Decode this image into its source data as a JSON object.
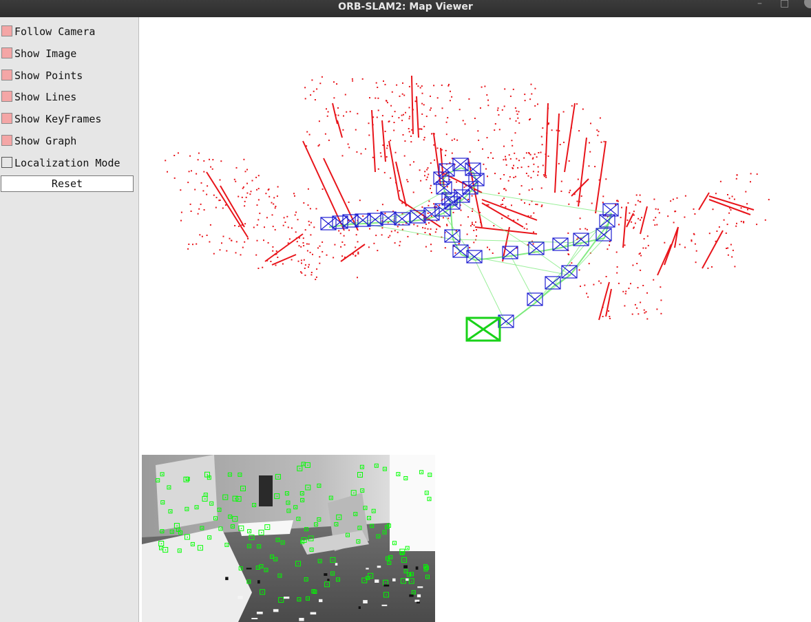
{
  "window": {
    "title": "ORB-SLAM2: Map Viewer"
  },
  "controls": [
    {
      "label": "Follow Camera",
      "checked": true
    },
    {
      "label": "Show Image",
      "checked": true
    },
    {
      "label": "Show Points",
      "checked": true
    },
    {
      "label": "Show Lines",
      "checked": true
    },
    {
      "label": "Show KeyFrames",
      "checked": true
    },
    {
      "label": "Show Graph",
      "checked": true
    },
    {
      "label": "Localization Mode",
      "checked": false
    }
  ],
  "reset_label": "Reset",
  "colors": {
    "map_points": "#e8141a",
    "keyframes": "#1e1ed2",
    "covisibility_graph": "#6ee86e",
    "current_camera": "#19d219",
    "checkbox_on": "#f4a6a6",
    "features": "#00ff00"
  }
}
